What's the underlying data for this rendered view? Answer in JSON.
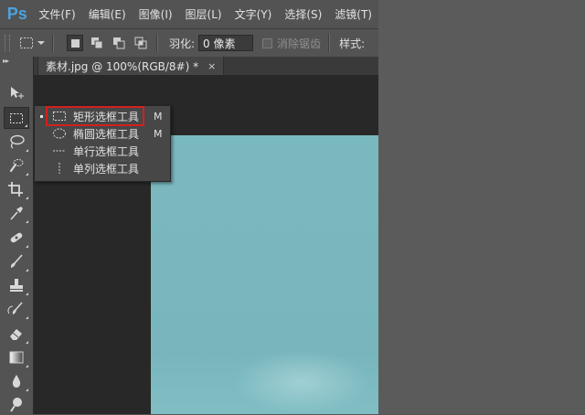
{
  "app": {
    "logo": "Ps"
  },
  "menu": {
    "items": [
      "文件(F)",
      "编辑(E)",
      "图像(I)",
      "图层(L)",
      "文字(Y)",
      "选择(S)",
      "滤镜(T)"
    ]
  },
  "options": {
    "feather_label": "羽化:",
    "feather_value": "0 像素",
    "antialias_label": "消除锯齿",
    "style_label": "样式:"
  },
  "document": {
    "tab_title": "素材.jpg @ 100%(RGB/8#) *",
    "close_glyph": "×"
  },
  "flyout": {
    "items": [
      {
        "label": "矩形选框工具",
        "shortcut": "M",
        "icon": "rect-marquee-icon",
        "selected": true
      },
      {
        "label": "椭圆选框工具",
        "shortcut": "M",
        "icon": "ellipse-marquee-icon",
        "selected": false
      },
      {
        "label": "单行选框工具",
        "shortcut": "",
        "icon": "single-row-marquee-icon",
        "selected": false
      },
      {
        "label": "单列选框工具",
        "shortcut": "",
        "icon": "single-column-marquee-icon",
        "selected": false
      }
    ]
  },
  "toolbar": {
    "collapse_glyph": "▸▸",
    "tools": [
      "move-tool",
      "marquee-tool",
      "lasso-tool",
      "quick-selection-tool",
      "crop-tool",
      "eyedropper-tool",
      "healing-brush-tool",
      "brush-tool",
      "clone-stamp-tool",
      "history-brush-tool",
      "eraser-tool",
      "gradient-tool",
      "blur-tool",
      "dodge-tool"
    ]
  },
  "colors": {
    "ui_bg": "#535353",
    "workspace": "#282828",
    "canvas_image": "#7ab8bf",
    "highlight": "#d2201f",
    "logo": "#4aa3df"
  }
}
